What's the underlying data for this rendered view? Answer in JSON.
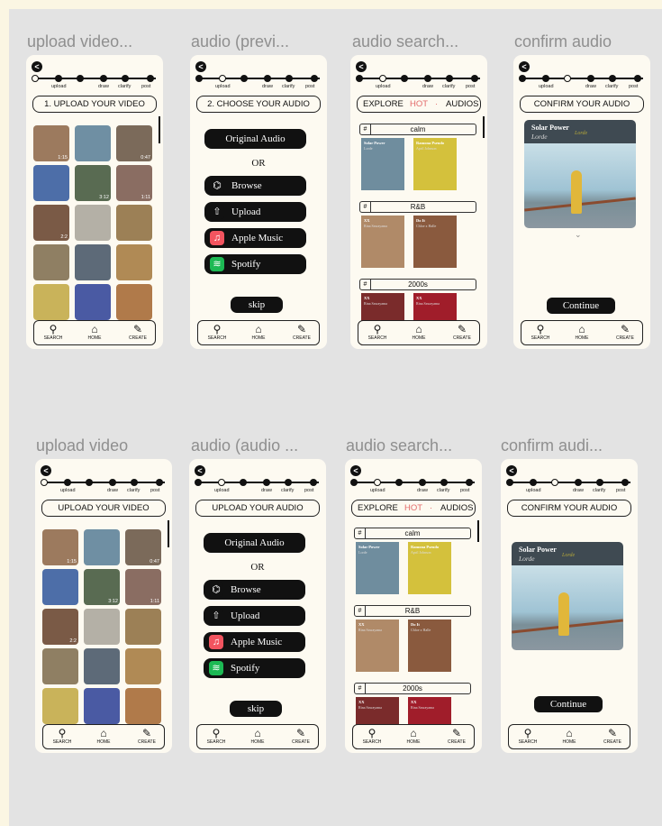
{
  "frame_labels": [
    "upload video...",
    "audio (previ...",
    "audio search...",
    "confirm audio",
    "upload video",
    "audio (audio ...",
    "audio search...",
    "confirm audi..."
  ],
  "progress_labels": [
    "upload",
    "draw",
    "clarify",
    "post"
  ],
  "nav": [
    {
      "label": "SEARCH",
      "icon": "search-icon"
    },
    {
      "label": "HOME",
      "icon": "home-icon"
    },
    {
      "label": "CREATE",
      "icon": "pencil-icon"
    }
  ],
  "back_glyph": "<",
  "upload": {
    "title_a": "1. UPLOAD YOUR VIDEO",
    "title_b": "UPLOAD YOUR VIDEO",
    "durations": [
      "1:15",
      "",
      "0:47",
      "",
      "3:12",
      "1:11",
      "2:2",
      "",
      "",
      "",
      "",
      "",
      "",
      "",
      ""
    ]
  },
  "choose": {
    "title_a": "2. CHOOSE YOUR AUDIO",
    "title_b": "UPLOAD YOUR AUDIO",
    "original": "Original Audio",
    "or": "OR",
    "options": [
      {
        "label": "Browse",
        "icon": "browse-icon",
        "glyph": "⌬",
        "color": "#111111"
      },
      {
        "label": "Upload",
        "icon": "upload-icon",
        "glyph": "⇧",
        "color": "#111111"
      },
      {
        "label": "Apple Music",
        "icon": "apple-music-icon",
        "glyph": "♫",
        "color": "#f2545f"
      },
      {
        "label": "Spotify",
        "icon": "spotify-icon",
        "glyph": "≋",
        "color": "#1db954"
      }
    ],
    "skip": "skip"
  },
  "search": {
    "tabs": [
      "EXPLORE",
      "HOT",
      "·",
      "AUDIOS"
    ],
    "genres": [
      "calm",
      "R&B",
      "2000s"
    ],
    "albums": [
      {
        "title": "Solar Power",
        "artist": "Lorde"
      },
      {
        "title": "Ramona Pseudo",
        "artist": "April Johnson"
      },
      {
        "title": "XX",
        "artist": "Rina Sawayama"
      },
      {
        "title": "Do It",
        "artist": "Chloe x Halle"
      },
      {
        "title": "XX",
        "artist": "Rina Sawayama"
      },
      {
        "title": "XX",
        "artist": "Rina Sawayama"
      }
    ]
  },
  "confirm": {
    "title": "CONFIRM YOUR AUDIO",
    "song": "Solar Power",
    "artist": "Lorde",
    "signature": "Lorde",
    "continue": "Continue"
  },
  "colors": {
    "accent_hot": "#e36b6b",
    "frame_bg": "#fdfaf1",
    "canvas": "#e3e3e3"
  }
}
